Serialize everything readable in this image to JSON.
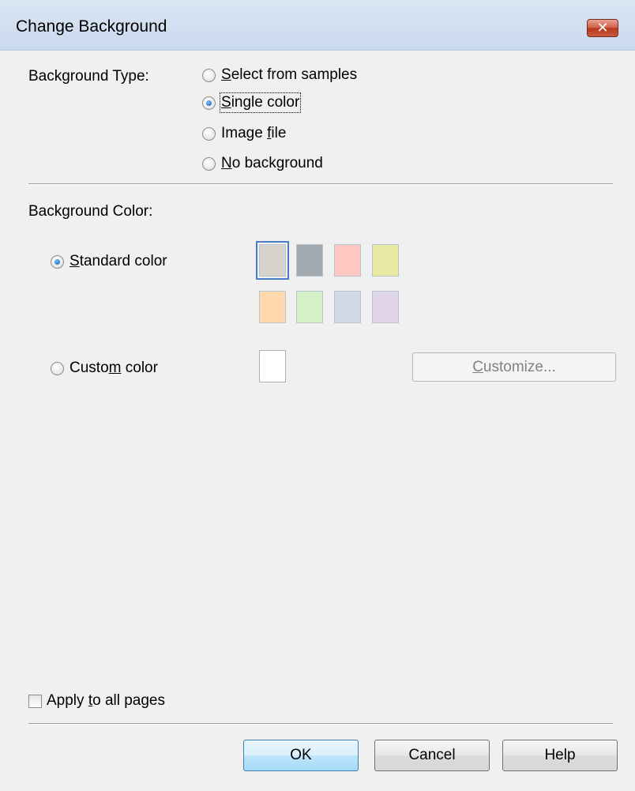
{
  "window": {
    "title": "Change Background",
    "close_symbol": "✕"
  },
  "background_type": {
    "label": "Background Type:",
    "options": [
      {
        "pre": "",
        "ul": "S",
        "post": "elect from samples",
        "checked": false
      },
      {
        "pre": "",
        "ul": "S",
        "post": "ingle color",
        "checked": true
      },
      {
        "pre": "Image ",
        "ul": "f",
        "post": "ile",
        "checked": false
      },
      {
        "pre": "",
        "ul": "N",
        "post": "o background",
        "checked": false
      }
    ]
  },
  "background_color": {
    "label": "Background Color:",
    "standard": {
      "pre": "",
      "ul": "S",
      "post": "tandard color",
      "checked": true
    },
    "custom": {
      "pre": "Custo",
      "ul": "m",
      "post": " color",
      "checked": false
    },
    "swatches": [
      "#d6d2cc",
      "#a2aaaf",
      "#ffc7c1",
      "#e9e9a3",
      "#ffd9ad",
      "#d5f0c6",
      "#d1d8e8",
      "#e0d4e8"
    ],
    "selected_swatch_index": 0,
    "custom_color": "#ffffff",
    "customize_button": {
      "pre": "",
      "ul": "C",
      "post": "ustomize..."
    }
  },
  "apply_all": {
    "pre": "Apply ",
    "ul": "t",
    "post": "o all pages",
    "checked": false
  },
  "buttons": {
    "ok": "OK",
    "cancel": "Cancel",
    "help": "Help"
  }
}
